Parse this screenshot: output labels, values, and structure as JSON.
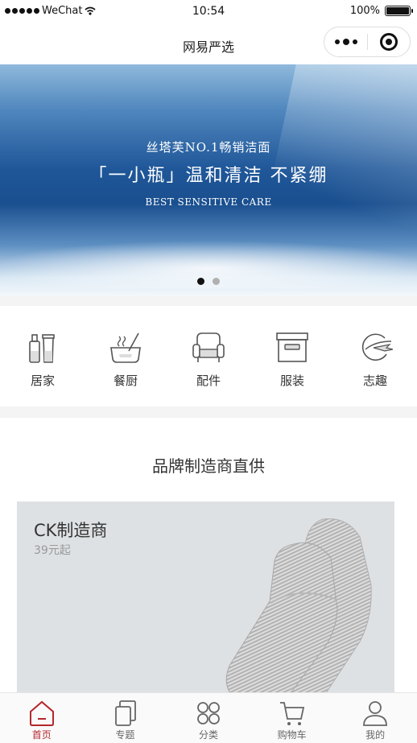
{
  "status_bar": {
    "carrier": "WeChat",
    "time": "10:54",
    "battery": "100%",
    "battery_level": 1.0
  },
  "nav": {
    "title": "网易严选"
  },
  "banner": {
    "line1": "丝塔芙NO.1畅销洁面",
    "line2": "「一小瓶」温和清洁 不紧绷",
    "line3": "BEST SENSITIVE CARE",
    "slide_count": 2,
    "active_slide": 1
  },
  "categories": [
    {
      "label": "居家",
      "icon": "home-goods-icon"
    },
    {
      "label": "餐厨",
      "icon": "kitchen-icon"
    },
    {
      "label": "配件",
      "icon": "armchair-icon"
    },
    {
      "label": "服装",
      "icon": "box-icon"
    },
    {
      "label": "志趣",
      "icon": "globe-plane-icon"
    }
  ],
  "section": {
    "title": "品牌制造商直供",
    "card": {
      "name": "CK制造商",
      "price": "39元起"
    }
  },
  "tabs": [
    {
      "label": "首页",
      "icon": "home-icon",
      "active": true
    },
    {
      "label": "专题",
      "icon": "pages-icon",
      "active": false
    },
    {
      "label": "分类",
      "icon": "grid-icon",
      "active": false
    },
    {
      "label": "购物车",
      "icon": "cart-icon",
      "active": false
    },
    {
      "label": "我的",
      "icon": "user-icon",
      "active": false
    }
  ],
  "colors": {
    "accent": "#b4282d",
    "banner_blue": "#1f5799",
    "card_bg": "#dee1e4"
  }
}
